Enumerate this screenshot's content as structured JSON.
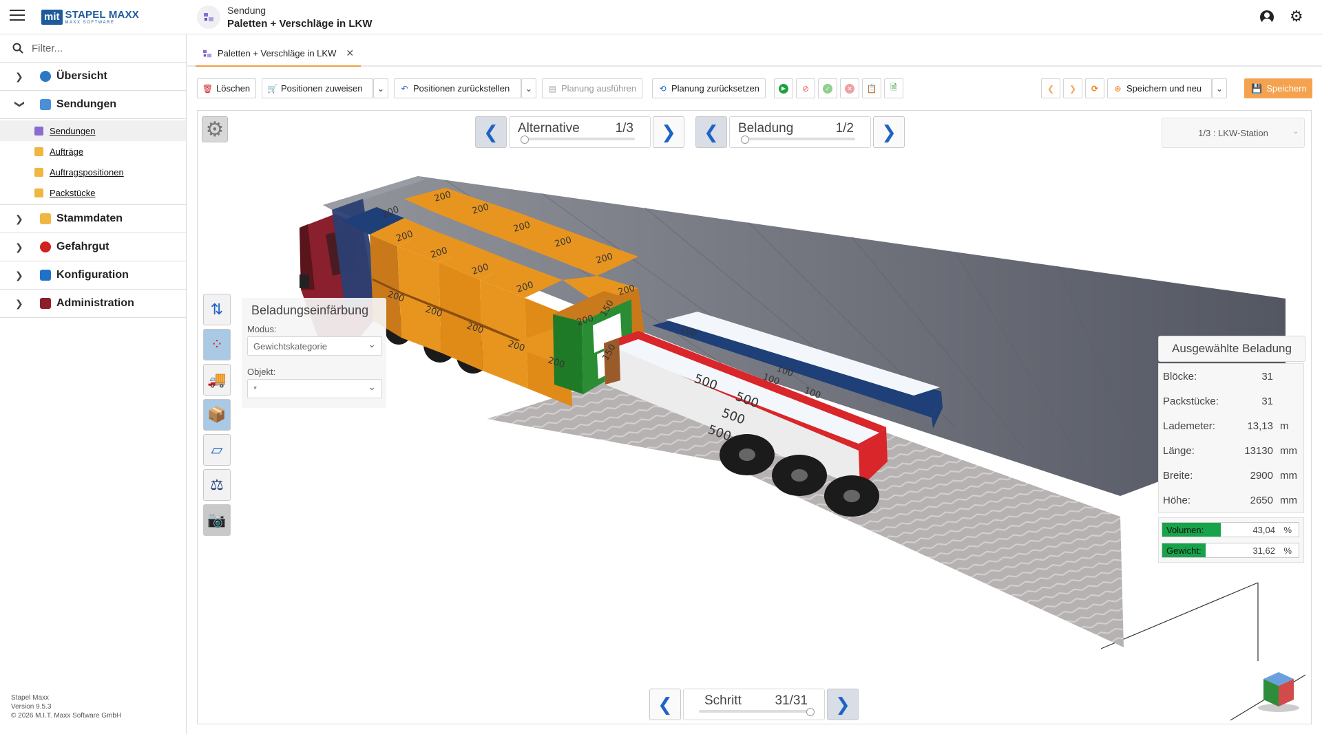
{
  "app": {
    "logo_badge": "mit",
    "logo_name": "STAPEL MAXX",
    "logo_sub": "MAXX SOFTWARE",
    "header_kind": "Sendung",
    "header_title": "Paletten + Verschläge in LKW"
  },
  "sidebar": {
    "filter_placeholder": "Filter...",
    "groups": [
      {
        "label": "Übersicht",
        "expanded": false,
        "color": "#2b78c5"
      },
      {
        "label": "Sendungen",
        "expanded": true,
        "color": "#4a8fd8"
      },
      {
        "label": "Stammdaten",
        "expanded": false,
        "color": "#f0b640"
      },
      {
        "label": "Gefahrgut",
        "expanded": false,
        "color": "#d12020"
      },
      {
        "label": "Konfiguration",
        "expanded": false,
        "color": "#1e73c8"
      },
      {
        "label": "Administration",
        "expanded": false,
        "color": "#8c1f2a"
      }
    ],
    "sub_items": [
      {
        "label": "Sendungen",
        "active": true,
        "color": "#8a6bd1"
      },
      {
        "label": "Aufträge",
        "active": false,
        "color": "#f0b640"
      },
      {
        "label": "Auftragspositionen",
        "active": false,
        "color": "#f0b640"
      },
      {
        "label": "Packstücke",
        "active": false,
        "color": "#f0b640"
      }
    ],
    "version_lines": [
      "Stapel Maxx",
      "Version 9.5.3",
      "© 2026 M.I.T. Maxx Software GmbH"
    ]
  },
  "tab": {
    "label": "Paletten + Verschläge in LKW",
    "close": "✕"
  },
  "toolbar": {
    "delete": "Löschen",
    "assign_positions": "Positionen zuweisen",
    "reset_positions": "Positionen zurückstellen",
    "execute_planning": "Planung ausführen",
    "reset_planning": "Planung zurücksetzen",
    "save_and_new": "Speichern und neu",
    "save": "Speichern",
    "save_color": "#f5a24e"
  },
  "viewer": {
    "alternative_label": "Alternative",
    "alternative_value": "1/3",
    "alternative_progress": 0.0,
    "loading_label": "Beladung",
    "loading_value": "1/2",
    "loading_progress": 0.0,
    "station": "1/3 : LKW-Station",
    "step_label": "Schritt",
    "step_value": "31/31",
    "step_progress": 1.0
  },
  "color_panel": {
    "title": "Beladungseinfärbung",
    "mode_label": "Modus:",
    "mode_value": "Gewichtskategorie",
    "object_label": "Objekt:",
    "object_value": "*"
  },
  "selected_load": {
    "title": "Ausgewählte Beladung",
    "rows": [
      {
        "label": "Blöcke:",
        "value": "31",
        "unit": ""
      },
      {
        "label": "Packstücke:",
        "value": "31",
        "unit": ""
      },
      {
        "label": "Lademeter:",
        "value": "13,13",
        "unit": "m"
      },
      {
        "label": "Länge:",
        "value": "13130",
        "unit": "mm"
      },
      {
        "label": "Breite:",
        "value": "2900",
        "unit": "mm"
      },
      {
        "label": "Höhe:",
        "value": "2650",
        "unit": "mm"
      }
    ],
    "volume_label": "Volumen:",
    "volume_value": "43,04",
    "volume_fraction": 0.4304,
    "weight_label": "Gewicht:",
    "weight_value": "31,62",
    "weight_fraction": 0.3162,
    "percent": "%"
  },
  "scene": {
    "crate_labels": [
      "200",
      "200",
      "200",
      "200",
      "200",
      "200",
      "200",
      "200",
      "200",
      "200",
      "200",
      "200",
      "200",
      "200",
      "200",
      "200",
      "200",
      "100",
      "100",
      "150",
      "150",
      "100",
      "100",
      "500",
      "500",
      "500",
      "500"
    ],
    "colors": {
      "crate": "#e8951f",
      "crate_dark": "#b56d12",
      "green": "#1f7a27",
      "red": "#d9262b",
      "blue": "#1e3f78",
      "truck": "#8a1f2d",
      "container": "#4b4f5a"
    }
  }
}
